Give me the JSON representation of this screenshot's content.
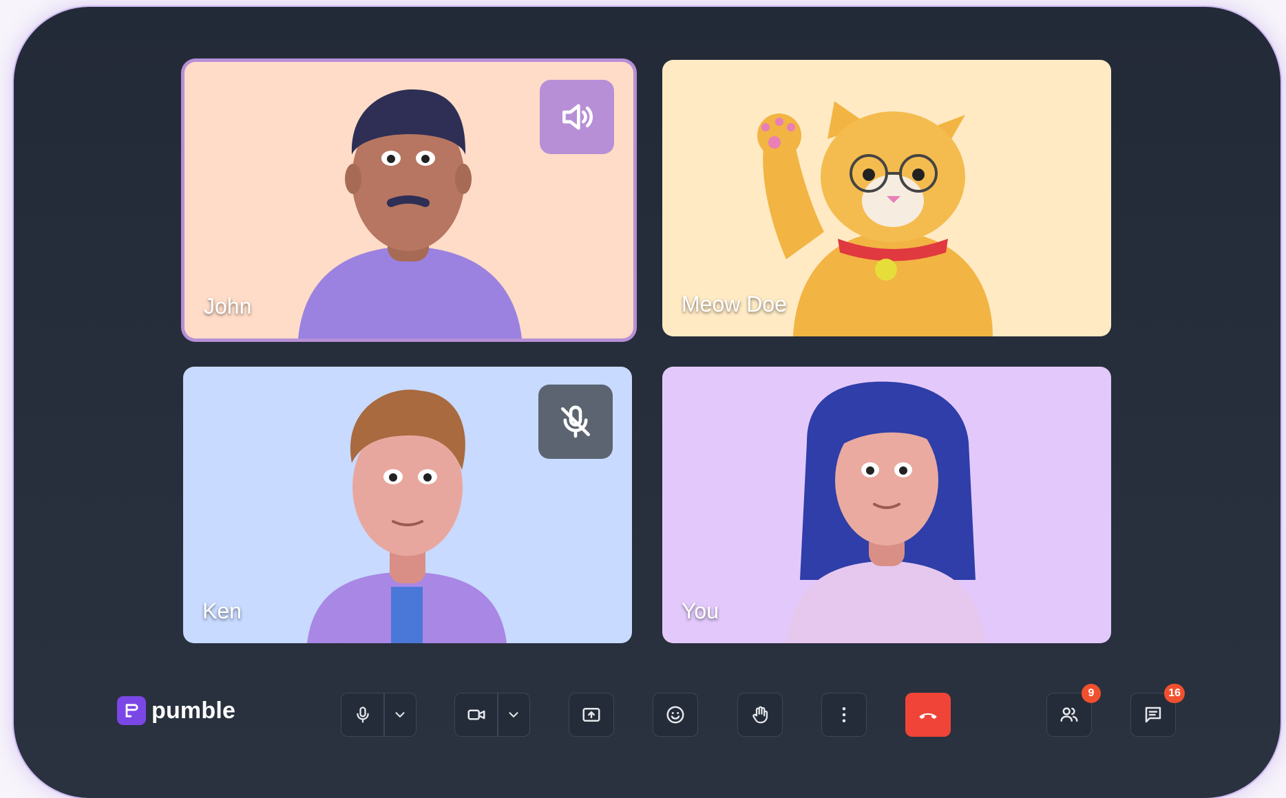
{
  "participants": [
    {
      "name": "John",
      "speaking": true
    },
    {
      "name": "Meow Doe",
      "speaking": false
    },
    {
      "name": "Ken",
      "muted": true
    },
    {
      "name": "You",
      "speaking": false
    }
  ],
  "toolbar": {
    "brand": "pumble",
    "participants_count": "9",
    "chat_count": "16"
  },
  "colors": {
    "john_bg": "#ffdcc8",
    "meow_bg": "#ffeac4",
    "ken_bg": "#c8daff",
    "you_bg": "#e3c9fb",
    "speaking_border": "#b78fd6",
    "end_call": "#f04438",
    "badge": "#f1502f",
    "brand": "#7b46e6"
  },
  "icons": {
    "speaking": "speaker-icon",
    "muted": "mic-off-icon",
    "mic": "mic-icon",
    "camera": "video-icon",
    "share": "screen-share-icon",
    "emoji": "emoji-icon",
    "hand": "raise-hand-icon",
    "more": "more-vertical-icon",
    "end": "phone-hangup-icon",
    "people": "people-icon",
    "chat": "chat-icon"
  }
}
